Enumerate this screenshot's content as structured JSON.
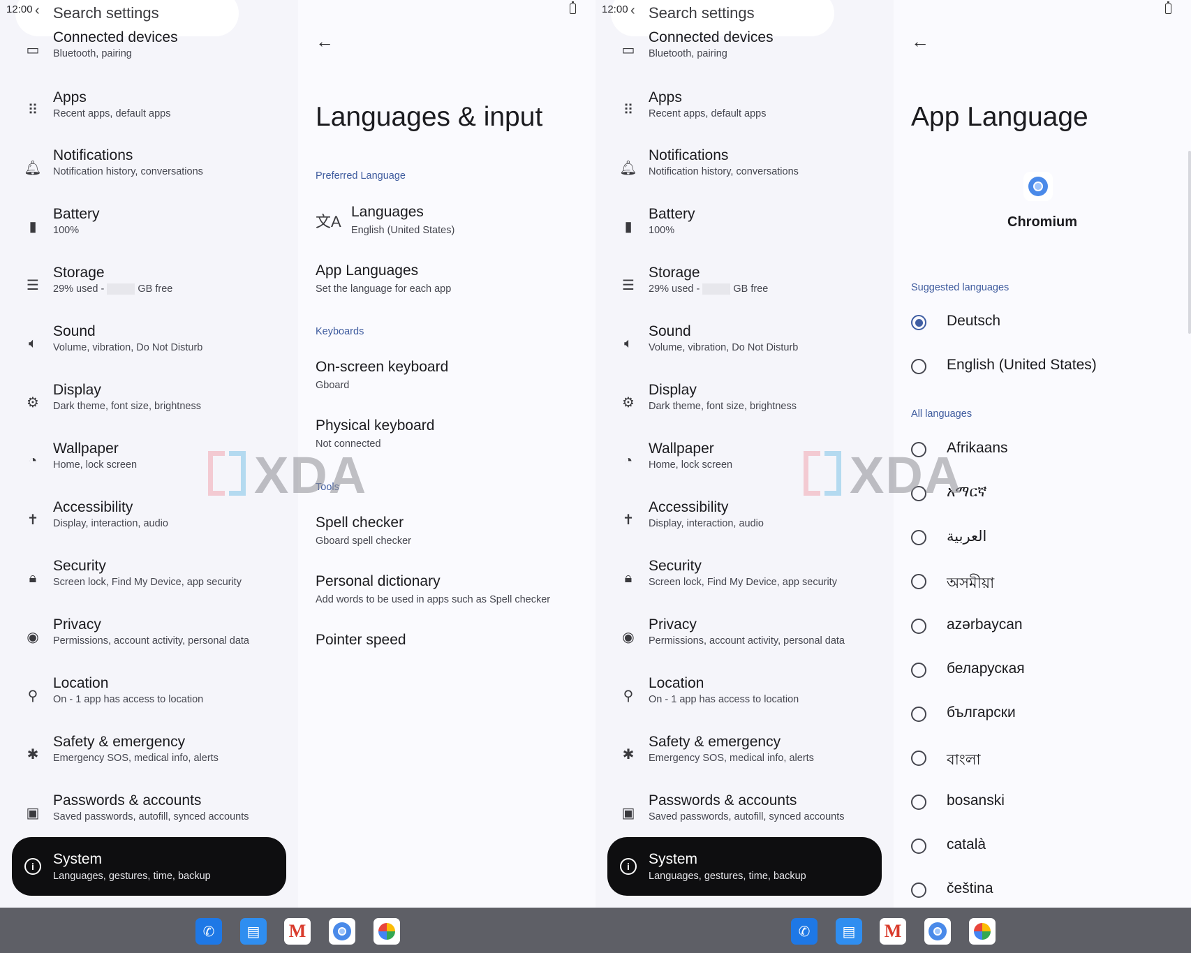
{
  "status": {
    "time": "12:00"
  },
  "search": {
    "label": "Search settings"
  },
  "settings_list": [
    {
      "icon": "connected-devices-icon",
      "title": "Connected devices",
      "subtitle": "Bluetooth, pairing"
    },
    {
      "icon": "apps-grid-icon",
      "title": "Apps",
      "subtitle": "Recent apps, default apps"
    },
    {
      "icon": "bell-icon",
      "title": "Notifications",
      "subtitle": "Notification history, conversations"
    },
    {
      "icon": "battery-icon",
      "title": "Battery",
      "subtitle": "100%"
    },
    {
      "icon": "storage-icon",
      "title": "Storage",
      "subtitle_prefix": "29% used -",
      "subtitle_suffix": "GB free"
    },
    {
      "icon": "speaker-icon",
      "title": "Sound",
      "subtitle": "Volume, vibration, Do Not Disturb"
    },
    {
      "icon": "brightness-icon",
      "title": "Display",
      "subtitle": "Dark theme, font size, brightness"
    },
    {
      "icon": "palette-icon",
      "title": "Wallpaper",
      "subtitle": "Home, lock screen"
    },
    {
      "icon": "accessibility-icon",
      "title": "Accessibility",
      "subtitle": "Display, interaction, audio"
    },
    {
      "icon": "lock-icon",
      "title": "Security",
      "subtitle": "Screen lock, Find My Device, app security"
    },
    {
      "icon": "privacy-eye-icon",
      "title": "Privacy",
      "subtitle": "Permissions, account activity, personal data"
    },
    {
      "icon": "location-pin-icon",
      "title": "Location",
      "subtitle": "On - 1 app has access to location"
    },
    {
      "icon": "asterisk-icon",
      "title": "Safety & emergency",
      "subtitle": "Emergency SOS, medical info, alerts"
    },
    {
      "icon": "account-box-icon",
      "title": "Passwords & accounts",
      "subtitle": "Saved passwords, autofill, synced accounts"
    }
  ],
  "system_item": {
    "icon": "info-icon",
    "title": "System",
    "subtitle": "Languages, gestures, time, backup"
  },
  "languages_input": {
    "title": "Languages & input",
    "preferred_header": "Preferred Language",
    "languages": {
      "title": "Languages",
      "subtitle": "English (United States)"
    },
    "app_languages": {
      "title": "App Languages",
      "subtitle": "Set the language for each app"
    },
    "keyboards_header": "Keyboards",
    "onscreen": {
      "title": "On-screen keyboard",
      "subtitle": "Gboard"
    },
    "physical": {
      "title": "Physical keyboard",
      "subtitle": "Not connected"
    },
    "tools_header": "Tools",
    "spell": {
      "title": "Spell checker",
      "subtitle": "Gboard spell checker"
    },
    "dictionary": {
      "title": "Personal dictionary",
      "subtitle": "Add words to be used in apps such as Spell checker"
    },
    "pointer": {
      "title": "Pointer speed"
    }
  },
  "app_language": {
    "title": "App Language",
    "app_name": "Chromium",
    "suggested_header": "Suggested languages",
    "suggested": [
      {
        "label": "Deutsch",
        "selected": true
      },
      {
        "label": "English (United States)",
        "selected": false
      }
    ],
    "all_header": "All languages",
    "all": [
      "Afrikaans",
      "አማርኛ",
      "العربية",
      "অসমীয়া",
      "azərbaycan",
      "беларуская",
      "български",
      "বাংলা",
      "bosanski",
      "català",
      "čeština"
    ]
  },
  "watermark": {
    "text": "XDA"
  },
  "taskbar": {
    "apps": [
      {
        "name": "phone-app",
        "icon": "phone-icon"
      },
      {
        "name": "messages-app",
        "icon": "messages-icon"
      },
      {
        "name": "gmail-app",
        "icon": "gmail-icon",
        "glyph": "M"
      },
      {
        "name": "chromium-app",
        "icon": "chromium-icon"
      },
      {
        "name": "photos-app",
        "icon": "photos-pinwheel-icon"
      }
    ]
  },
  "colors": {
    "accent": "#3f5ea3",
    "section_header": "#3e5b9e",
    "selected_pill": "#0e0e10",
    "taskbar": "#5e5f66"
  }
}
